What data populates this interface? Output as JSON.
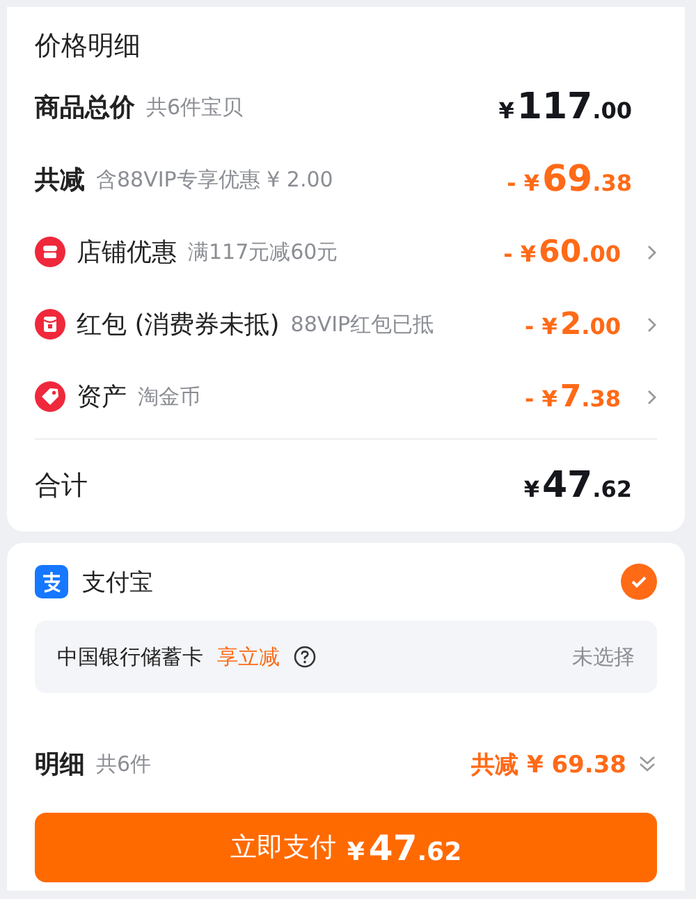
{
  "price_details": {
    "title": "价格明细",
    "rows": [
      {
        "kind": "total",
        "label": "商品总价",
        "note": "共6件宝贝",
        "amount": {
          "symbol": "¥",
          "main": "117",
          "fraction": ".00"
        }
      },
      {
        "kind": "total",
        "label": "共减",
        "note": "含88VIP专享优惠 ¥ 2.00",
        "amount": {
          "sign": "- ",
          "symbol": "¥",
          "main": "69",
          "fraction": ".38"
        }
      },
      {
        "kind": "discount",
        "label": "店铺优惠",
        "note": "满117元减60元",
        "amount": {
          "sign": "- ",
          "symbol": "¥",
          "main": "60",
          "fraction": ".00"
        }
      },
      {
        "kind": "discount",
        "label": "红包 (消费券未抵)",
        "note": "88VIP红包已抵",
        "amount": {
          "sign": "- ",
          "symbol": "¥",
          "main": "2",
          "fraction": ".00"
        }
      },
      {
        "kind": "discount",
        "label": "资产",
        "note": "淘金币",
        "amount": {
          "sign": "- ",
          "symbol": "¥",
          "main": "7",
          "fraction": ".38"
        }
      }
    ],
    "sum": {
      "label": "合计",
      "amount": {
        "symbol": "¥",
        "main": "47",
        "fraction": ".62"
      }
    }
  },
  "payment": {
    "method": {
      "name": "支付宝",
      "selected": true
    },
    "card": {
      "name": "中国银行储蓄卡",
      "promo": "享立减",
      "status": "未选择"
    }
  },
  "summary": {
    "label": "明细",
    "count": "共6件",
    "discount": "共减 ¥ 69.38"
  },
  "pay_button": {
    "label": "立即支付",
    "amount": {
      "symbol": "¥",
      "main": "47",
      "fraction": ".62"
    }
  }
}
